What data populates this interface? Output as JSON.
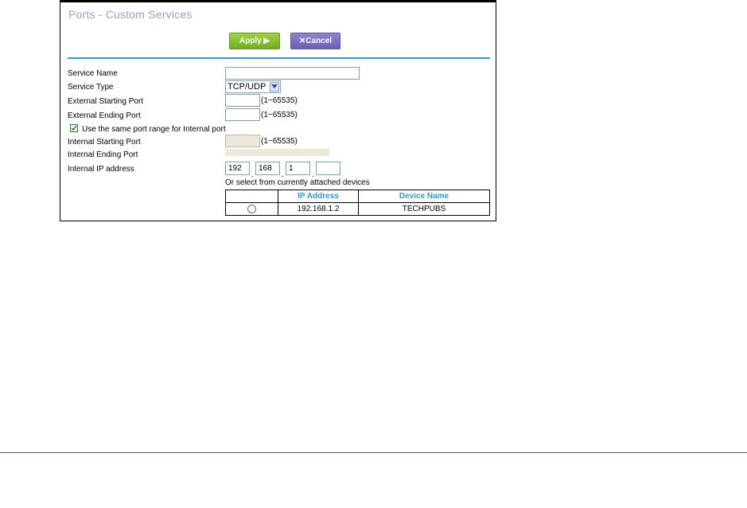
{
  "page": {
    "title": "Ports - Custom Services",
    "buttons": {
      "apply": "Apply ▶",
      "cancel": "✕Cancel"
    },
    "form": {
      "service_name_label": "Service Name",
      "service_name_value": "",
      "service_type_label": "Service Type",
      "service_type_value": "TCP/UDP",
      "ext_start_label": "External Starting Port",
      "ext_start_value": "",
      "ext_start_range": "(1~65535)",
      "ext_end_label": "External Ending Port",
      "ext_end_value": "",
      "ext_end_range": "(1~65535)",
      "same_range_label": "Use the same port range for Internal port",
      "same_range_checked": true,
      "int_start_label": "Internal Starting Port",
      "int_start_value": "",
      "int_start_range": "(1~65535)",
      "int_end_label": "Internal Ending Port",
      "ip_label": "Internal IP address",
      "ip": [
        "192",
        "168",
        "1",
        ""
      ]
    },
    "devices": {
      "caption": "Or select from currently attached devices",
      "columns": [
        "",
        "IP Address",
        "Device Name"
      ],
      "rows": [
        {
          "ip": "192.168.1.2",
          "name": "TECHPUBS"
        }
      ]
    }
  },
  "colors": {
    "title": "#9c9ac8",
    "accent": "#2d9ad0",
    "apply": "#7cbc2a",
    "cancel": "#7b70c4"
  }
}
